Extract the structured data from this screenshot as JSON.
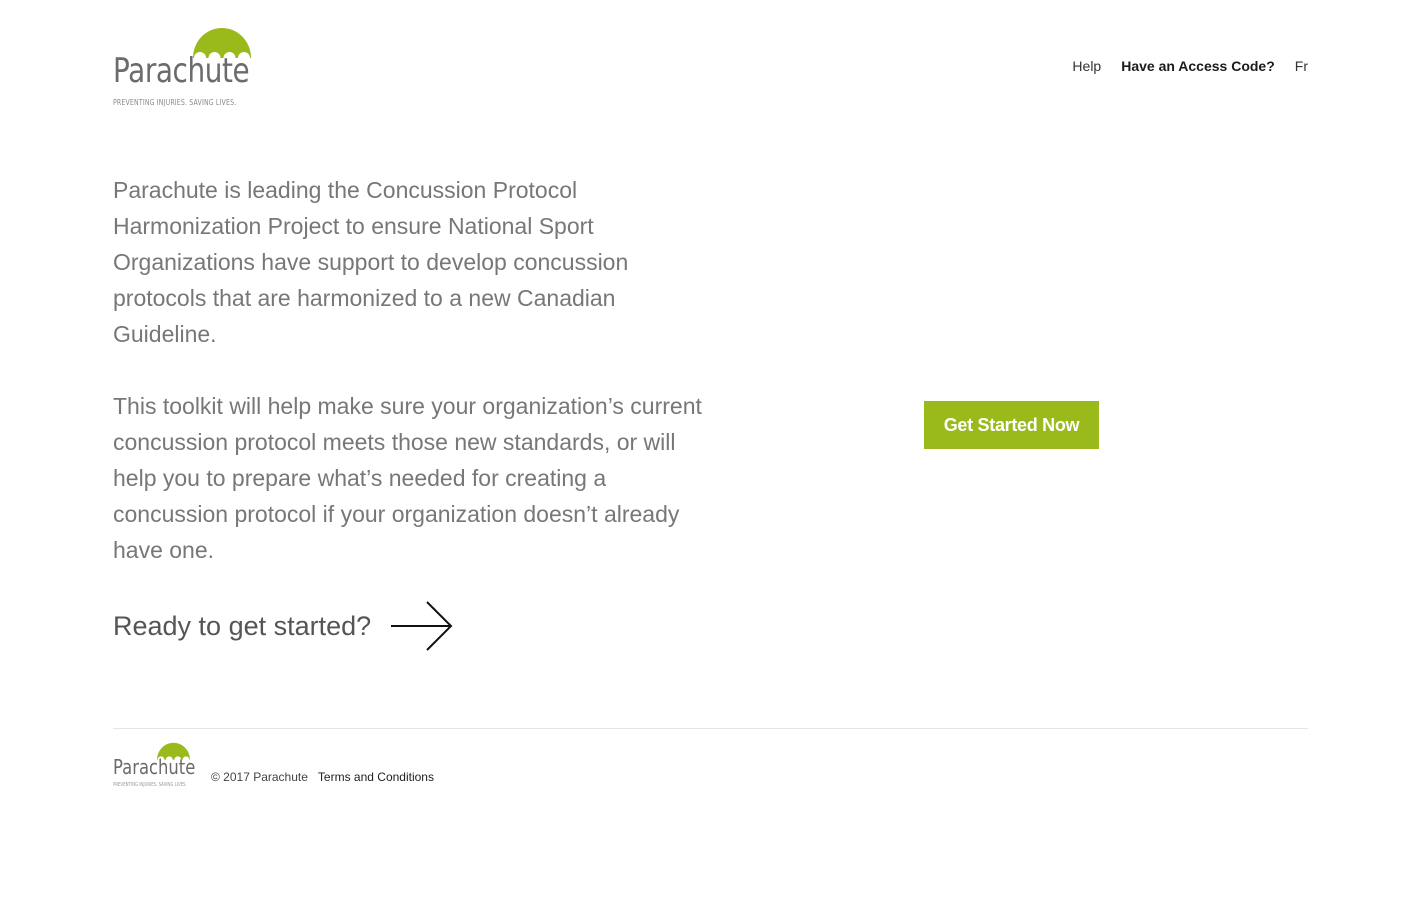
{
  "header": {
    "logo": {
      "brand": "Parachute",
      "tagline": "PREVENTING INJURIES. SAVING LIVES."
    },
    "nav": {
      "help": "Help",
      "access_code": "Have an Access Code?",
      "language": "Fr"
    }
  },
  "main": {
    "intro": "Parachute is leading the Concussion Protocol Harmonization Project to ensure National Sport Organizations have support to develop concussion protocols that are harmonized to a new Canadian Guideline.",
    "toolkit": "This toolkit will help make sure your organization’s current concussion protocol meets those new standards, or will help you to prepare what’s needed for creating a concussion protocol if your organization doesn’t already have one.",
    "ready": "Ready to get started?",
    "cta_label": "Get Started Now"
  },
  "footer": {
    "logo": {
      "brand": "Parachute",
      "tagline": "PREVENTING INJURIES. SAVING LIVES."
    },
    "copyright": "© 2017 Parachute",
    "terms": "Terms and Conditions"
  },
  "colors": {
    "brand_green": "#9ab91a",
    "text_gray": "#777777"
  },
  "icons": {
    "logo_dome": "parachute-canopy-icon",
    "ready_arrow": "arrow-right-icon"
  }
}
